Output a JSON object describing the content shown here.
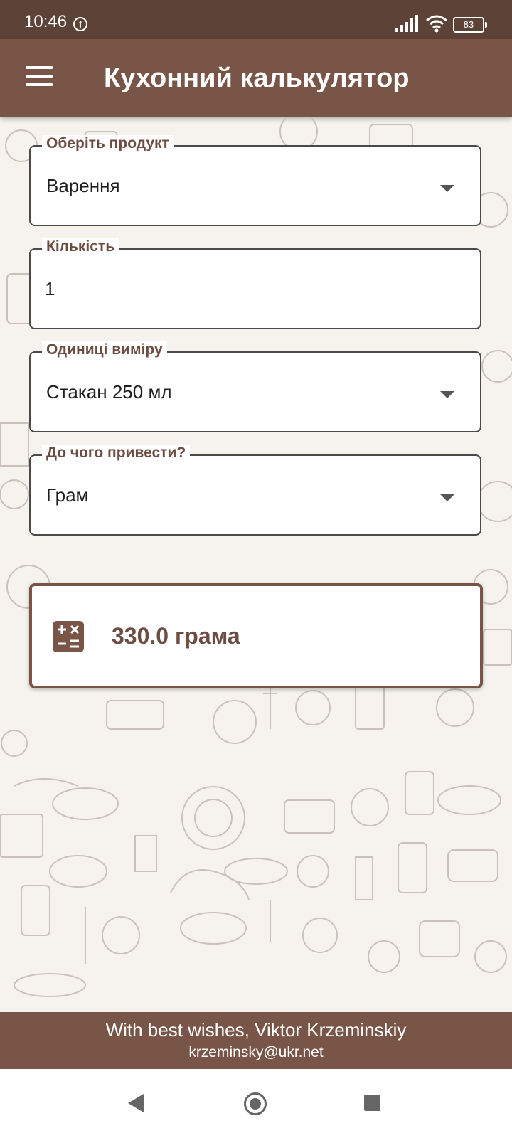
{
  "status_bar": {
    "time": "10:46",
    "battery": "83",
    "notification_icon": "facebook-icon"
  },
  "app_bar": {
    "title": "Кухонний калькулятор",
    "menu_icon": "hamburger-menu-icon"
  },
  "form": {
    "product": {
      "label": "Оберіть продукт",
      "value": "Варення"
    },
    "quantity": {
      "label": "Кількість",
      "value": "1"
    },
    "units": {
      "label": "Одиниці виміру",
      "value": "Стакан 250 мл"
    },
    "convert_to": {
      "label": "До чого привести?",
      "value": "Грам"
    }
  },
  "result": {
    "text": "330.0 грама",
    "icon": "calculator-icon"
  },
  "footer": {
    "line1": "With best wishes, Viktor Krzeminskiy",
    "line2": "krzeminsky@ukr.net"
  },
  "nav": {
    "back_icon": "back-triangle-icon",
    "home_icon": "home-circle-icon",
    "recents_icon": "recents-square-icon"
  },
  "colors": {
    "primary": "#795548",
    "status_bar": "#5d4337",
    "accent_text": "#6d4c41"
  }
}
